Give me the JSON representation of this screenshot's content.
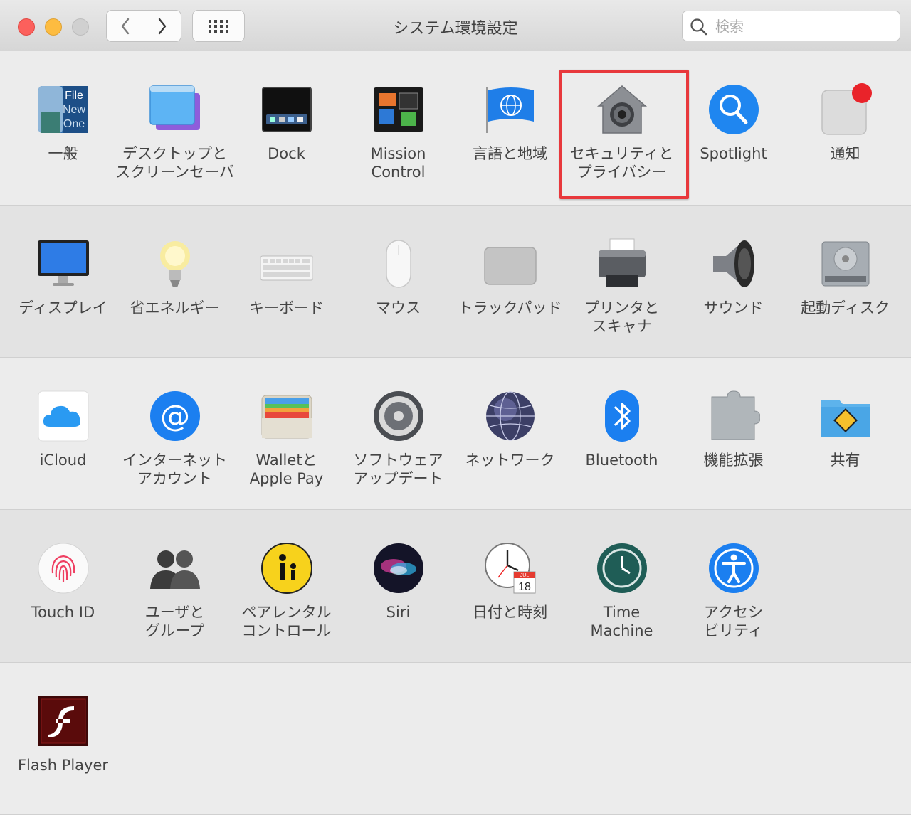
{
  "window": {
    "title": "システム環境設定"
  },
  "search": {
    "placeholder": "検索"
  },
  "rows": [
    [
      {
        "label": "一般",
        "icon": "general-icon"
      },
      {
        "label": "デスクトップと\nスクリーンセーバ",
        "icon": "desktop-icon"
      },
      {
        "label": "Dock",
        "icon": "dock-icon"
      },
      {
        "label": "Mission\nControl",
        "icon": "mission-control-icon"
      },
      {
        "label": "言語と地域",
        "icon": "language-flag-icon"
      },
      {
        "label": "セキュリティと\nプライバシー",
        "icon": "security-house-icon"
      },
      {
        "label": "Spotlight",
        "icon": "spotlight-search-icon"
      },
      {
        "label": "通知",
        "icon": "notifications-icon"
      }
    ],
    [
      {
        "label": "ディスプレイ",
        "icon": "display-icon"
      },
      {
        "label": "省エネルギー",
        "icon": "lightbulb-icon"
      },
      {
        "label": "キーボード",
        "icon": "keyboard-icon"
      },
      {
        "label": "マウス",
        "icon": "mouse-icon"
      },
      {
        "label": "トラックパッド",
        "icon": "trackpad-icon"
      },
      {
        "label": "プリンタと\nスキャナ",
        "icon": "printer-icon"
      },
      {
        "label": "サウンド",
        "icon": "speaker-icon"
      },
      {
        "label": "起動ディスク",
        "icon": "hard-disk-icon"
      }
    ],
    [
      {
        "label": "iCloud",
        "icon": "icloud-icon"
      },
      {
        "label": "インターネット\nアカウント",
        "icon": "at-sign-icon"
      },
      {
        "label": "Walletと\nApple Pay",
        "icon": "wallet-icon"
      },
      {
        "label": "ソフトウェア\nアップデート",
        "icon": "software-update-gear-icon"
      },
      {
        "label": "ネットワーク",
        "icon": "network-globe-icon"
      },
      {
        "label": "Bluetooth",
        "icon": "bluetooth-icon"
      },
      {
        "label": "機能拡張",
        "icon": "puzzle-piece-icon"
      },
      {
        "label": "共有",
        "icon": "sharing-folder-icon"
      }
    ],
    [
      {
        "label": "Touch ID",
        "icon": "fingerprint-icon"
      },
      {
        "label": "ユーザと\nグループ",
        "icon": "users-icon"
      },
      {
        "label": "ペアレンタル\nコントロール",
        "icon": "parental-controls-icon"
      },
      {
        "label": "Siri",
        "icon": "siri-icon"
      },
      {
        "label": "日付と時刻",
        "icon": "clock-calendar-icon"
      },
      {
        "label": "Time\nMachine",
        "icon": "time-machine-icon"
      },
      {
        "label": "アクセシ\nビリティ",
        "icon": "accessibility-icon"
      }
    ],
    [
      {
        "label": "Flash Player",
        "icon": "flash-player-icon"
      }
    ]
  ],
  "general_icon_text": [
    "File",
    "New",
    "One"
  ],
  "calendar_icon_text": {
    "month": "JUL",
    "day": "18"
  },
  "colors": {
    "highlight": "#e8383c",
    "notification_badge": "#e9232a"
  }
}
